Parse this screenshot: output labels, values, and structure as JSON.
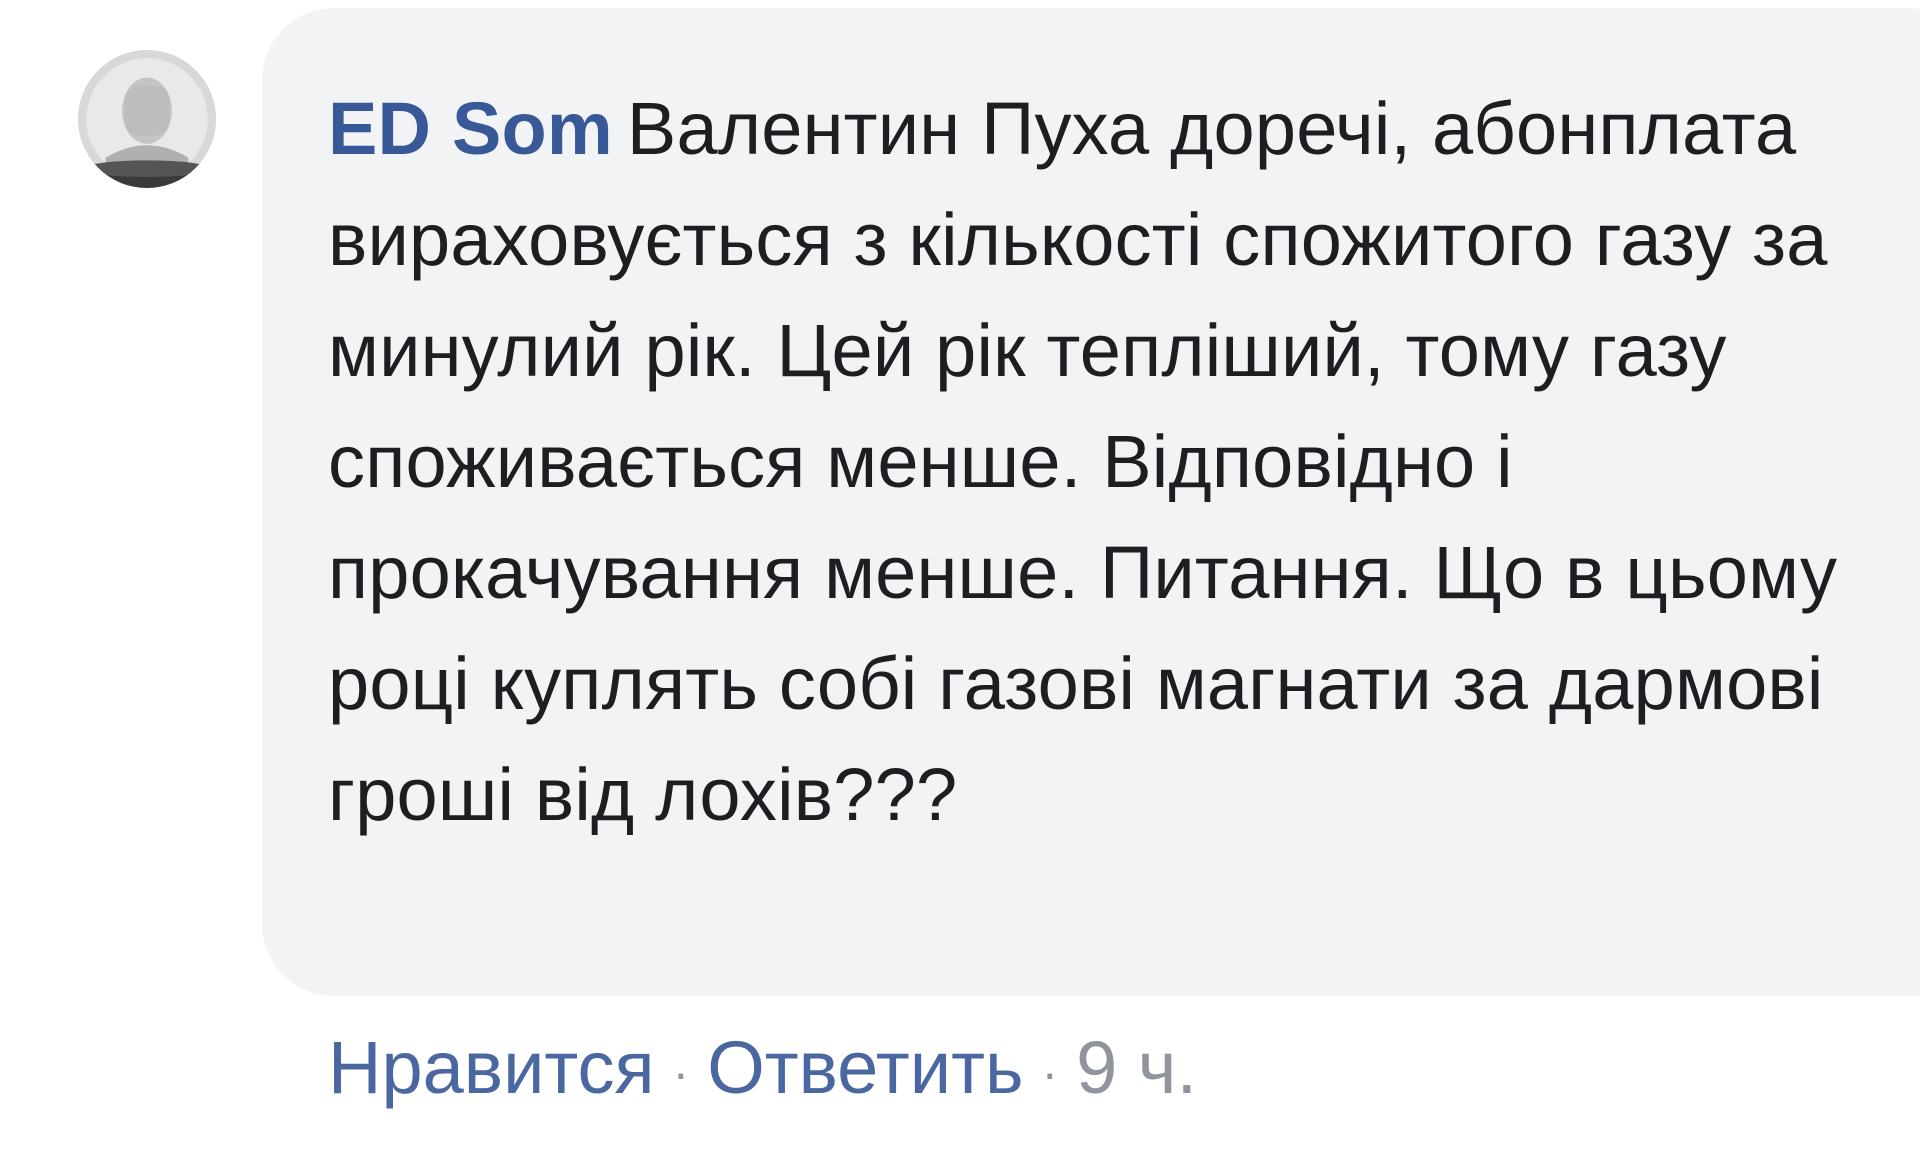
{
  "comment": {
    "author": "ED Som",
    "text": "Валентин Пуха доречі, абонплата вираховується з кількості спожитого газу за минулий рік. Цей рік тепліший, тому газу споживається менше. Відповідно і прокачування менше. Питання. Що в цьому році куплять собі газові магнати за дармові гроші від лохів???",
    "actions": {
      "like_label": "Нравится",
      "reply_label": "Ответить",
      "separator": "·",
      "timestamp": "9 ч."
    }
  },
  "colors": {
    "author": "#385898",
    "bubble": "#f2f3f5",
    "text": "#1c1e21",
    "link": "#4b67a1",
    "meta": "#90949c"
  }
}
